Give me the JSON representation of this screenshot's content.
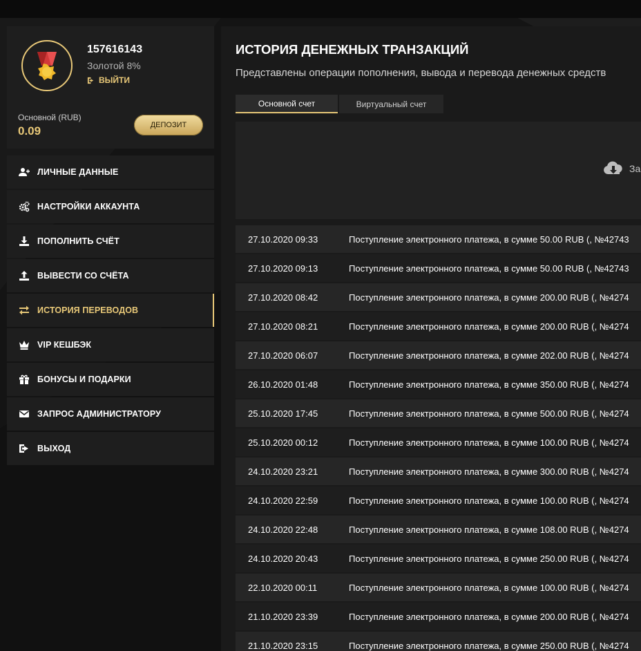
{
  "profile": {
    "user_id": "157616143",
    "level": "Золотой 8%",
    "logout_label": "ВЫЙТИ",
    "balance_label": "Основной (RUB)",
    "balance_value": "0.09",
    "deposit_label": "ДЕПОЗИТ"
  },
  "nav": {
    "items": [
      {
        "label": "ЛИЧНЫЕ ДАННЫЕ",
        "icon": "user-add-icon"
      },
      {
        "label": "НАСТРОЙКИ АККАУНТА",
        "icon": "gears-icon"
      },
      {
        "label": "ПОПОЛНИТЬ СЧЁТ",
        "icon": "download-tray-icon"
      },
      {
        "label": "ВЫВЕСТИ СО СЧЁТА",
        "icon": "upload-tray-icon"
      },
      {
        "label": "ИСТОРИЯ ПЕРЕВОДОВ",
        "icon": "exchange-arrows-icon",
        "active": true
      },
      {
        "label": "VIP КЕШБЭК",
        "icon": "crown-icon"
      },
      {
        "label": "БОНУСЫ И ПОДАРКИ",
        "icon": "gift-icon"
      },
      {
        "label": "ЗАПРОС АДМИНИСТРАТОРУ",
        "icon": "envelope-icon"
      },
      {
        "label": "ВЫХОД",
        "icon": "sign-out-icon"
      }
    ]
  },
  "main": {
    "title": "ИСТОРИЯ ДЕНЕЖНЫХ ТРАНЗАКЦИЙ",
    "subtitle": "Представлены операции пополнения, вывода и перевода денежных средств",
    "tabs": [
      {
        "label": "Основной счет",
        "active": true
      },
      {
        "label": "Виртуальный счет",
        "active": false
      }
    ],
    "export_label": "За"
  },
  "transactions": [
    {
      "date": "27.10.2020 09:33",
      "desc": "Поступление электронного платежа, в сумме 50.00 RUB (, №42743"
    },
    {
      "date": "27.10.2020 09:13",
      "desc": "Поступление электронного платежа, в сумме 50.00 RUB (, №42743"
    },
    {
      "date": "27.10.2020 08:42",
      "desc": "Поступление электронного платежа, в сумме 200.00 RUB (, №4274"
    },
    {
      "date": "27.10.2020 08:21",
      "desc": "Поступление электронного платежа, в сумме 200.00 RUB (, №4274"
    },
    {
      "date": "27.10.2020 06:07",
      "desc": "Поступление электронного платежа, в сумме 202.00 RUB (, №4274"
    },
    {
      "date": "26.10.2020 01:48",
      "desc": "Поступление электронного платежа, в сумме 350.00 RUB (, №4274"
    },
    {
      "date": "25.10.2020 17:45",
      "desc": "Поступление электронного платежа, в сумме 500.00 RUB (, №4274"
    },
    {
      "date": "25.10.2020 00:12",
      "desc": "Поступление электронного платежа, в сумме 100.00 RUB (, №4274"
    },
    {
      "date": "24.10.2020 23:21",
      "desc": "Поступление электронного платежа, в сумме 300.00 RUB (, №4274"
    },
    {
      "date": "24.10.2020 22:59",
      "desc": "Поступление электронного платежа, в сумме 100.00 RUB (, №4274"
    },
    {
      "date": "24.10.2020 22:48",
      "desc": "Поступление электронного платежа, в сумме 108.00 RUB (, №4274"
    },
    {
      "date": "24.10.2020 20:43",
      "desc": "Поступление электронного платежа, в сумме 250.00 RUB (, №4274"
    },
    {
      "date": "22.10.2020 00:11",
      "desc": "Поступление электронного платежа, в сумме 100.00 RUB (, №4274"
    },
    {
      "date": "21.10.2020 23:39",
      "desc": "Поступление электронного платежа, в сумме 200.00 RUB (, №4274"
    },
    {
      "date": "21.10.2020 23:15",
      "desc": "Поступление электронного платежа, в сумме 250.00 RUB (, №4274"
    }
  ],
  "colors": {
    "accent": "#e8c878",
    "panel": "#1e1e1e",
    "background": "#141414"
  }
}
